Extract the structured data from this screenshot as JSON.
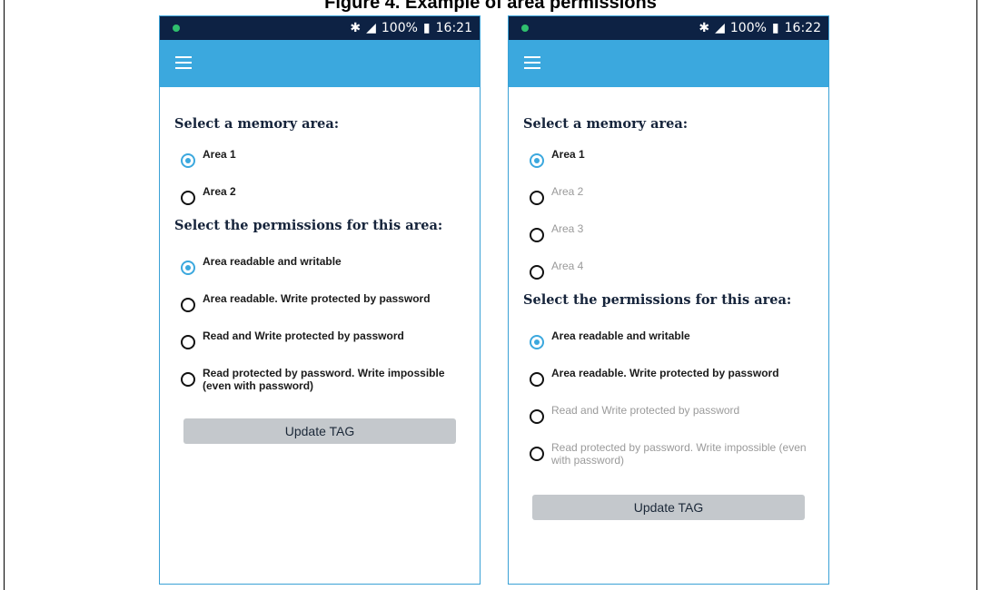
{
  "caption": "Figure 4. Example of area permissions",
  "screens": [
    {
      "status": {
        "bluetooth_icon": "bluetooth-icon",
        "signal_icon": "signal-icon",
        "battery_text": "100%",
        "time": "16:21"
      },
      "title_area": "Select a memory area:",
      "areas": [
        {
          "label": "Area 1",
          "selected": true,
          "enabled": true
        },
        {
          "label": "Area 2",
          "selected": false,
          "enabled": true
        }
      ],
      "title_permissions": "Select the permissions for this area:",
      "permissions": [
        {
          "label": "Area readable and writable",
          "selected": true,
          "enabled": true
        },
        {
          "label": "Area readable. Write protected by password",
          "selected": false,
          "enabled": true
        },
        {
          "label": "Read and Write protected by password",
          "selected": false,
          "enabled": true
        },
        {
          "label": "Read protected by password. Write impossible (even with password)",
          "selected": false,
          "enabled": true
        }
      ],
      "update_label": "Update TAG"
    },
    {
      "status": {
        "bluetooth_icon": "bluetooth-icon",
        "signal_icon": "signal-icon",
        "battery_text": "100%",
        "time": "16:22"
      },
      "title_area": "Select a memory area:",
      "areas": [
        {
          "label": "Area 1",
          "selected": true,
          "enabled": true
        },
        {
          "label": "Area 2",
          "selected": false,
          "enabled": false
        },
        {
          "label": "Area 3",
          "selected": false,
          "enabled": false
        },
        {
          "label": "Area 4",
          "selected": false,
          "enabled": false
        }
      ],
      "title_permissions": "Select the permissions for this area:",
      "permissions": [
        {
          "label": "Area readable and writable",
          "selected": true,
          "enabled": true
        },
        {
          "label": "Area readable. Write protected by password",
          "selected": false,
          "enabled": true
        },
        {
          "label": "Read and Write protected by password",
          "selected": false,
          "enabled": false
        },
        {
          "label": "Read protected by password. Write impossible (even with password)",
          "selected": false,
          "enabled": false
        }
      ],
      "update_label": "Update TAG"
    }
  ],
  "colors": {
    "status_bar": "#0d2244",
    "app_bar": "#3ba8de",
    "accent": "#3ba8de",
    "button": "#c4c8cc"
  }
}
